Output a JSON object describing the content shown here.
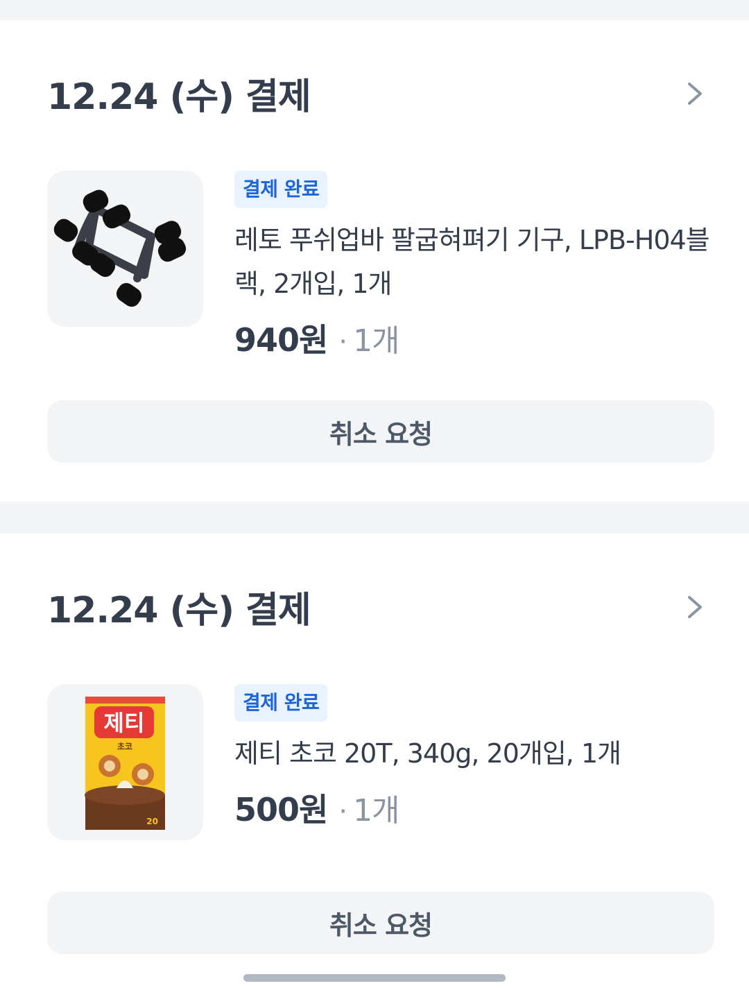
{
  "orders": [
    {
      "date_label": "12.24 (수) 결제",
      "status_badge": "결제 완료",
      "product_name": "레토 푸쉬업바 팔굽혀펴기 기구, LPB-H04블랙, 2개입, 1개",
      "price": "940원",
      "separator": "·",
      "quantity": "1개",
      "cancel_label": "취소 요청",
      "image_icon": "pushup-bar-product-image"
    },
    {
      "date_label": "12.24 (수) 결제",
      "status_badge": "결제 완료",
      "product_name": "제티 초코 20T, 340g, 20개입, 1개",
      "price": "500원",
      "separator": "·",
      "quantity": "1개",
      "cancel_label": "취소 요청",
      "image_icon": "jetty-choco-product-image",
      "image_text": {
        "brand": "제티",
        "sub": "초코",
        "count": "20"
      }
    }
  ],
  "colors": {
    "background": "#f2f4f6",
    "card": "#ffffff",
    "badge_bg": "#e8f3ff",
    "badge_text": "#1b64da",
    "text_primary": "#333d4b",
    "text_secondary": "#8b95a1"
  }
}
